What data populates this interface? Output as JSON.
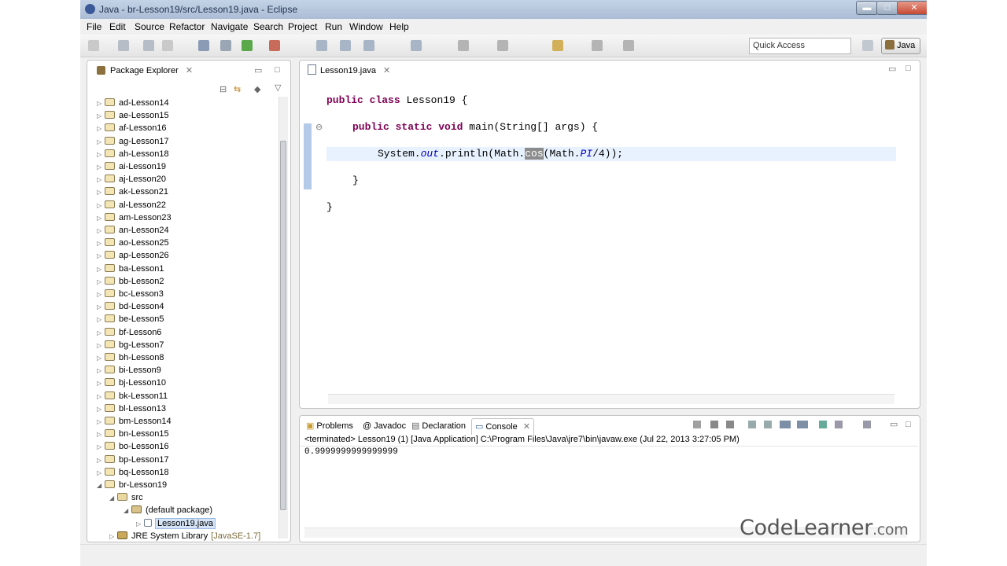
{
  "window": {
    "title": "Java - br-Lesson19/src/Lesson19.java - Eclipse",
    "min_glyph": "▬",
    "max_glyph": "□",
    "close_glyph": "✕"
  },
  "menu": [
    "File",
    "Edit",
    "Source",
    "Refactor",
    "Navigate",
    "Search",
    "Project",
    "Run",
    "Window",
    "Help"
  ],
  "toolbar": {
    "quick_access": "Quick Access",
    "perspective": "Java"
  },
  "package_explorer": {
    "tab_label": "Package Explorer",
    "close_glyph": "✕",
    "projects": [
      "ad-Lesson14",
      "ae-Lesson15",
      "af-Lesson16",
      "ag-Lesson17",
      "ah-Lesson18",
      "ai-Lesson19",
      "aj-Lesson20",
      "ak-Lesson21",
      "al-Lesson22",
      "am-Lesson23",
      "an-Lesson24",
      "ao-Lesson25",
      "ap-Lesson26",
      "ba-Lesson1",
      "bb-Lesson2",
      "bc-Lesson3",
      "bd-Lesson4",
      "be-Lesson5",
      "bf-Lesson6",
      "bg-Lesson7",
      "bh-Lesson8",
      "bi-Lesson9",
      "bj-Lesson10",
      "bk-Lesson11",
      "bl-Lesson13",
      "bm-Lesson14",
      "bn-Lesson15",
      "bo-Lesson16",
      "bp-Lesson17",
      "bq-Lesson18"
    ],
    "expanded_project": "br-Lesson19",
    "src_folder": "src",
    "default_package": "(default package)",
    "file": "Lesson19.java",
    "jre": "JRE System Library",
    "jre_version": "[JavaSE-1.7]"
  },
  "editor": {
    "tab_label": "Lesson19.java",
    "close_glyph": "✕",
    "fold_glyph": "⊖",
    "code": {
      "l1_kw1": "public",
      "l1_kw2": "class",
      "l1_rest": "Lesson19 {",
      "l2_kw1": "public",
      "l2_kw2": "static",
      "l2_kw3": "void",
      "l2_rest": "main(String[] args) {",
      "l3_a": "System.",
      "l3_out": "out",
      "l3_b": ".println(Math.",
      "l3_sel": "cos",
      "l3_c": "(Math.",
      "l3_pi": "PI",
      "l3_d": "/4));",
      "l4": "}",
      "l5": "}"
    }
  },
  "bottom_panel": {
    "tabs": [
      "Problems",
      "Javadoc",
      "Declaration",
      "Console"
    ],
    "active_tab": "Console",
    "console_header": "<terminated> Lesson19 (1) [Java Application] C:\\Program Files\\Java\\jre7\\bin\\javaw.exe (Jul 22, 2013 3:27:05 PM)",
    "console_output": "0.9999999999999999"
  },
  "watermark": {
    "main": "CodeLearner",
    "suffix": ".com"
  },
  "colors": {
    "keyword": "#7f0055",
    "field_italic": "#0000c0",
    "selection_bg": "#d5e4f6"
  }
}
